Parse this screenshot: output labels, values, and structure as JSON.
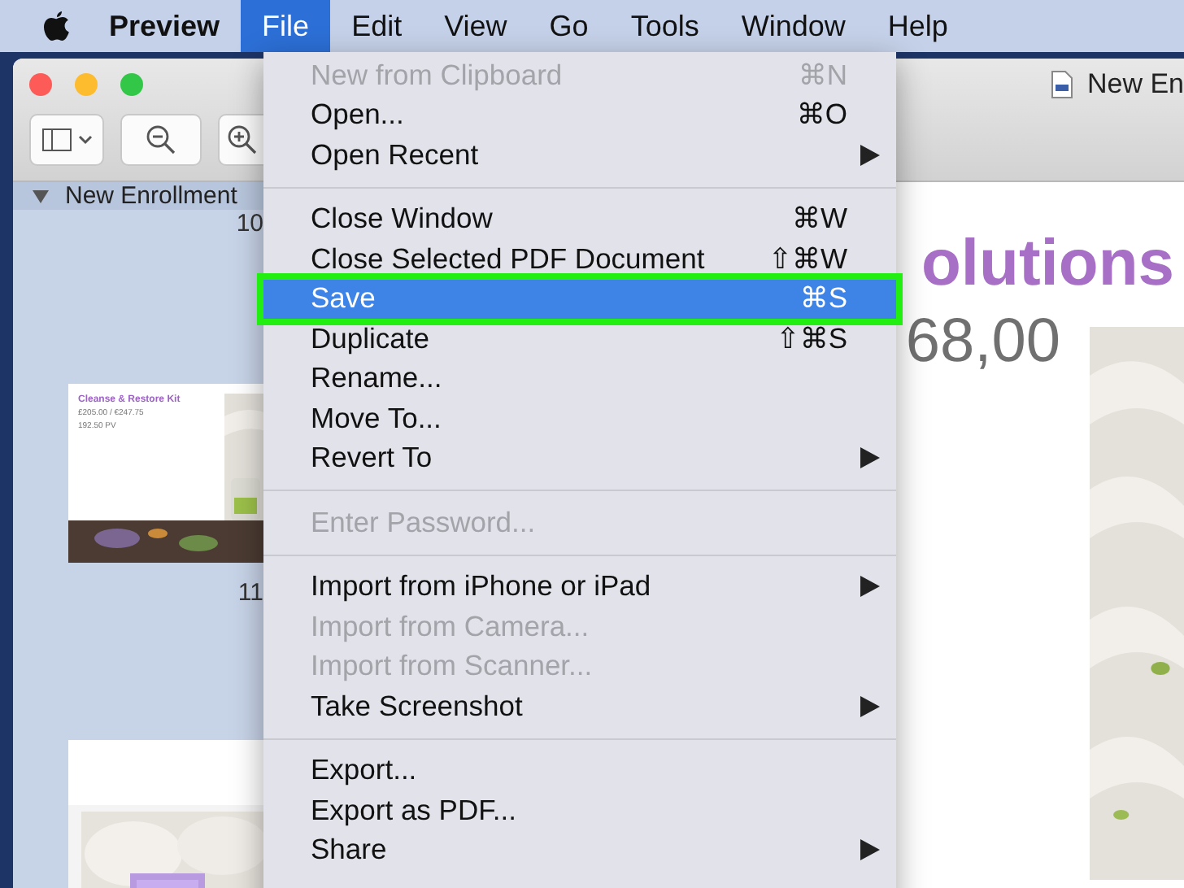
{
  "menu_bar": {
    "app_name": "Preview",
    "menus": [
      {
        "label": "File",
        "selected": true
      },
      {
        "label": "Edit",
        "selected": false
      },
      {
        "label": "View",
        "selected": false
      },
      {
        "label": "Go",
        "selected": false
      },
      {
        "label": "Tools",
        "selected": false
      },
      {
        "label": "Window",
        "selected": false
      },
      {
        "label": "Help",
        "selected": false
      }
    ]
  },
  "file_menu": {
    "items": [
      {
        "kind": "item",
        "label": "New from Clipboard",
        "shortcut": "⌘N",
        "disabled": true,
        "selected": false,
        "submenu": false
      },
      {
        "kind": "item",
        "label": "Open...",
        "shortcut": "⌘O",
        "disabled": false,
        "selected": false,
        "submenu": false
      },
      {
        "kind": "item",
        "label": "Open Recent",
        "disabled": false,
        "selected": false,
        "submenu": true
      },
      {
        "kind": "separator"
      },
      {
        "kind": "item",
        "label": "Close Window",
        "shortcut": "⌘W",
        "disabled": false,
        "selected": false,
        "submenu": false
      },
      {
        "kind": "item",
        "label": "Close Selected PDF Document",
        "shortcut": "⇧⌘W",
        "disabled": false,
        "selected": false,
        "submenu": false
      },
      {
        "kind": "item",
        "label": "Save",
        "shortcut": "⌘S",
        "disabled": false,
        "selected": true,
        "submenu": false
      },
      {
        "kind": "item",
        "label": "Duplicate",
        "shortcut": "⇧⌘S",
        "disabled": false,
        "selected": false,
        "submenu": false
      },
      {
        "kind": "item",
        "label": "Rename...",
        "disabled": false,
        "selected": false,
        "submenu": false
      },
      {
        "kind": "item",
        "label": "Move To...",
        "disabled": false,
        "selected": false,
        "submenu": false
      },
      {
        "kind": "item",
        "label": "Revert To",
        "disabled": false,
        "selected": false,
        "submenu": true
      },
      {
        "kind": "separator"
      },
      {
        "kind": "item",
        "label": "Enter Password...",
        "disabled": true,
        "selected": false,
        "submenu": false
      },
      {
        "kind": "separator"
      },
      {
        "kind": "item",
        "label": "Import from iPhone or iPad",
        "disabled": false,
        "selected": false,
        "submenu": true
      },
      {
        "kind": "item",
        "label": "Import from Camera...",
        "disabled": true,
        "selected": false,
        "submenu": false
      },
      {
        "kind": "item",
        "label": "Import from Scanner...",
        "disabled": true,
        "selected": false,
        "submenu": false
      },
      {
        "kind": "item",
        "label": "Take Screenshot",
        "disabled": false,
        "selected": false,
        "submenu": true
      },
      {
        "kind": "separator"
      },
      {
        "kind": "item",
        "label": "Export...",
        "disabled": false,
        "selected": false,
        "submenu": false
      },
      {
        "kind": "item",
        "label": "Export as PDF...",
        "disabled": false,
        "selected": false,
        "submenu": false
      },
      {
        "kind": "item",
        "label": "Share",
        "disabled": false,
        "selected": false,
        "submenu": true
      }
    ]
  },
  "window": {
    "title": "New En",
    "sidebar": {
      "document": "New Enrollment",
      "expanded": true,
      "pages": [
        {
          "kind": "label",
          "text": "10"
        },
        {
          "kind": "thumbnail",
          "title": "Cleanse & Restore Kit",
          "lines": [
            "£205.00 / €247.75",
            "192.50 PV"
          ]
        },
        {
          "kind": "label",
          "text": "11"
        },
        {
          "kind": "thumbnail"
        }
      ]
    },
    "document": {
      "heading": "olutions",
      "price": "68,00"
    }
  }
}
